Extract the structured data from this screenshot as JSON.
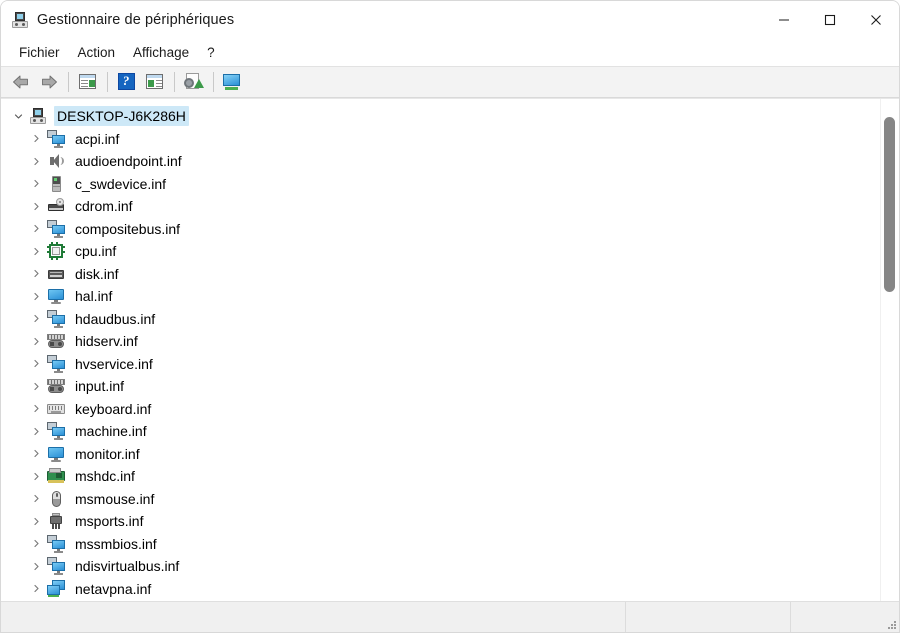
{
  "window": {
    "title": "Gestionnaire de périphériques",
    "icon": "device-manager-icon",
    "controls": {
      "minimize": "—",
      "maximize": "□",
      "close": "✕"
    }
  },
  "menu": {
    "items": [
      {
        "label": "Fichier",
        "name": "menu-fichier"
      },
      {
        "label": "Action",
        "name": "menu-action"
      },
      {
        "label": "Affichage",
        "name": "menu-affichage"
      },
      {
        "label": "?",
        "name": "menu-aide"
      }
    ]
  },
  "toolbar": {
    "buttons": [
      {
        "name": "back-button",
        "icon": "back-arrow-icon",
        "tooltip": "Précédent"
      },
      {
        "name": "forward-button",
        "icon": "forward-arrow-icon",
        "tooltip": "Suivant"
      },
      {
        "name": "properties-button",
        "icon": "properties-icon",
        "tooltip": "Propriétés"
      },
      {
        "name": "help-button",
        "icon": "help-icon",
        "tooltip": "Aide"
      },
      {
        "name": "update-driver-button",
        "icon": "update-driver-icon",
        "tooltip": "Mettre à jour le pilote"
      },
      {
        "name": "scan-hardware-button",
        "icon": "scan-hardware-icon",
        "tooltip": "Rechercher les modifications sur le matériel"
      },
      {
        "name": "show-hidden-devices-button",
        "icon": "display-devices-icon",
        "tooltip": "Afficher les périphériques"
      }
    ]
  },
  "tree": {
    "root": {
      "label": "DESKTOP-J6K286H",
      "icon": "computer-icon",
      "expanded": true,
      "selected": true,
      "twisty": "ˇ"
    },
    "collapsed_twisty": "›",
    "items": [
      {
        "label": "acpi.inf",
        "icon": "stacked-computer-icon"
      },
      {
        "label": "audioendpoint.inf",
        "icon": "speaker-icon"
      },
      {
        "label": "c_swdevice.inf",
        "icon": "tower-icon"
      },
      {
        "label": "cdrom.inf",
        "icon": "cdrom-icon"
      },
      {
        "label": "compositebus.inf",
        "icon": "stacked-computer-icon"
      },
      {
        "label": "cpu.inf",
        "icon": "cpu-chip-icon"
      },
      {
        "label": "disk.inf",
        "icon": "disk-drive-icon"
      },
      {
        "label": "hal.inf",
        "icon": "monitor-icon"
      },
      {
        "label": "hdaudbus.inf",
        "icon": "stacked-computer-icon"
      },
      {
        "label": "hidserv.inf",
        "icon": "hid-device-icon"
      },
      {
        "label": "hvservice.inf",
        "icon": "stacked-computer-icon"
      },
      {
        "label": "input.inf",
        "icon": "hid-device-icon"
      },
      {
        "label": "keyboard.inf",
        "icon": "keyboard-icon"
      },
      {
        "label": "machine.inf",
        "icon": "stacked-computer-icon"
      },
      {
        "label": "monitor.inf",
        "icon": "monitor-icon"
      },
      {
        "label": "mshdc.inf",
        "icon": "storage-controller-icon"
      },
      {
        "label": "msmouse.inf",
        "icon": "mouse-icon"
      },
      {
        "label": "msports.inf",
        "icon": "port-icon"
      },
      {
        "label": "mssmbios.inf",
        "icon": "stacked-computer-icon"
      },
      {
        "label": "ndisvirtualbus.inf",
        "icon": "stacked-computer-icon"
      },
      {
        "label": "netavpna.inf",
        "icon": "network-adapter-icon"
      }
    ]
  },
  "scrollbar": {
    "vertical": {
      "thumb_top_pct": 4,
      "thumb_height_pct": 35
    }
  },
  "statusbar": {
    "panes": [
      "",
      "",
      ""
    ]
  },
  "colors": {
    "selection": "#cde8f7",
    "toolbar_bg": "#f3f3f3",
    "statusbar_bg": "#f0f0f0",
    "accent_blue": "#3aa3e3"
  }
}
